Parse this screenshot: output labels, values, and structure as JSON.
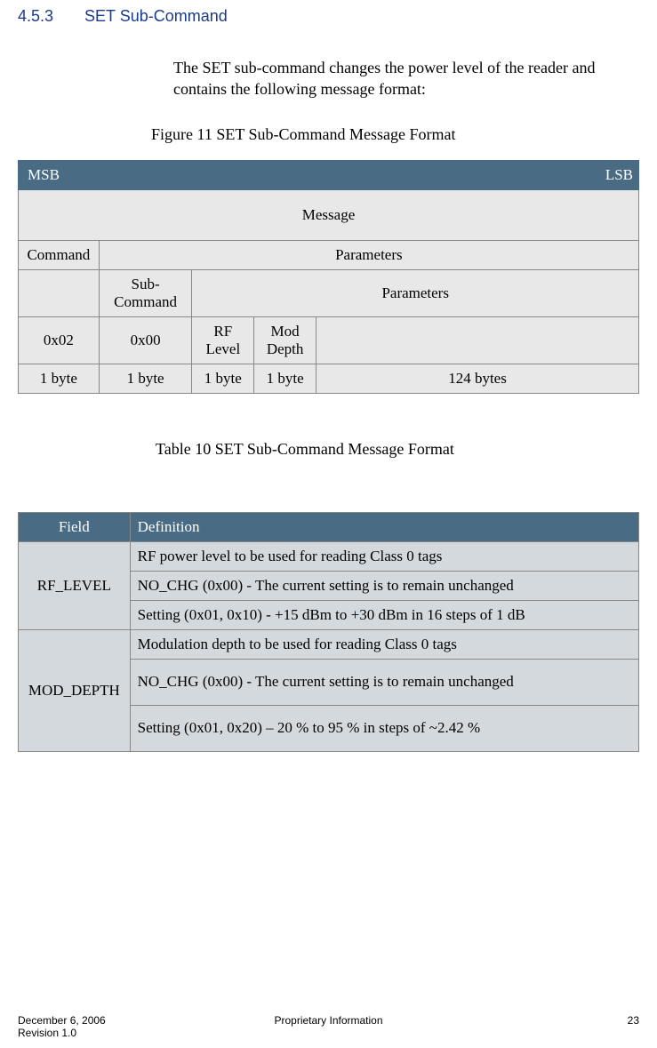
{
  "section": {
    "number": "4.5.3",
    "title": "SET Sub-Command"
  },
  "intro": "The SET sub-command changes the power level of the reader and contains the following message format:",
  "figure_caption": "Figure 11 SET Sub-Command Message Format",
  "table_caption": "Table 10 SET Sub-Command Message Format",
  "msg_table": {
    "msb": "MSB",
    "lsb": "LSB",
    "message": "Message",
    "command": "Command",
    "parameters": "Parameters",
    "sub_command": "Sub-Command",
    "parameters2": "Parameters",
    "val_cmd": "0x02",
    "val_sub": "0x00",
    "rf_level": "RF Level",
    "mod_depth": "Mod Depth",
    "size_cmd": "1 byte",
    "size_sub": "1 byte",
    "size_rf": "1 byte",
    "size_mod": "1 byte",
    "size_rest": "124 bytes"
  },
  "def_table": {
    "field_hdr": "Field",
    "definition_hdr": "Definition",
    "rows": [
      {
        "field": "RF_LEVEL",
        "defs": [
          "RF power level to be used for reading Class 0 tags",
          "NO_CHG (0x00) - The current setting is to remain unchanged",
          "Setting (0x01, 0x10) - +15 dBm to +30 dBm in 16 steps of 1 dB"
        ]
      },
      {
        "field": "MOD_DEPTH",
        "defs": [
          "Modulation depth to be used for reading Class 0 tags",
          "NO_CHG (0x00) - The current setting is to remain unchanged",
          "Setting (0x01, 0x20) – 20 % to 95 % in steps of ~2.42 %"
        ]
      }
    ]
  },
  "footer": {
    "date": "December 6, 2006",
    "revision": "Revision 1.0",
    "center": "Proprietary Information",
    "page": "23"
  }
}
